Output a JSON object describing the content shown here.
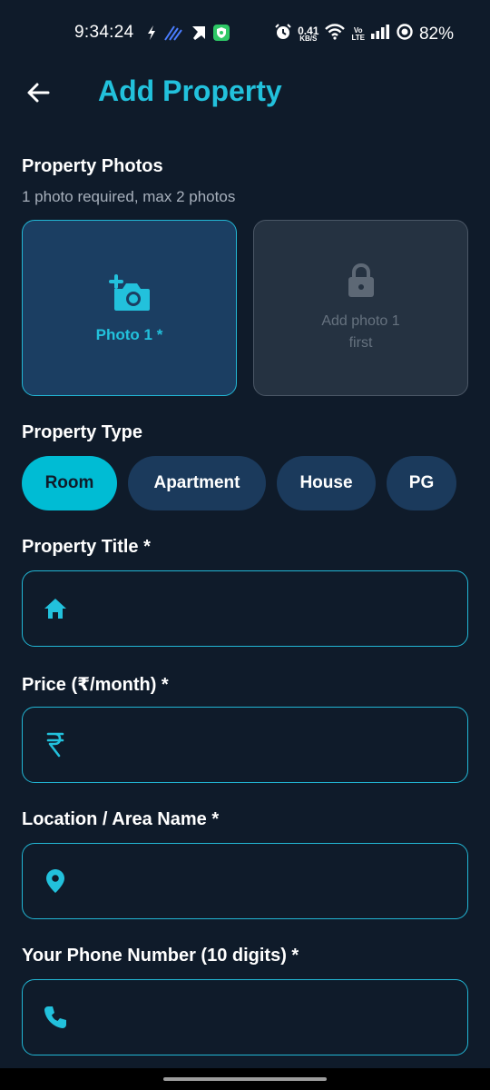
{
  "status_bar": {
    "time": "9:34:24",
    "net_speed_value": "0.41",
    "net_speed_unit": "KB/S",
    "volte_top": "Vo",
    "volte_bottom": "LTE",
    "battery": "82%"
  },
  "header": {
    "title": "Add Property",
    "back_icon": "arrow-left-icon"
  },
  "photos": {
    "label": "Property Photos",
    "hint": "1 photo required, max 2 photos",
    "slot1_label": "Photo 1 *",
    "slot2_label": "Add photo 1 first"
  },
  "property_type": {
    "label": "Property Type",
    "options": [
      "Room",
      "Apartment",
      "House",
      "PG"
    ],
    "selected": "Room"
  },
  "fields": {
    "title": {
      "label": "Property Title *",
      "value": "",
      "icon": "home-icon"
    },
    "price": {
      "label": "Price (₹/month) *",
      "value": "",
      "icon": "rupee-icon"
    },
    "location": {
      "label": "Location / Area Name *",
      "value": "",
      "icon": "location-pin-icon"
    },
    "phone": {
      "label": "Your Phone Number (10 digits) *",
      "value": "",
      "icon": "phone-icon"
    }
  },
  "colors": {
    "background": "#0f1b2a",
    "accent": "#22c1dc",
    "chip": "#1b3a5c",
    "chip_selected": "#00bcd4"
  }
}
